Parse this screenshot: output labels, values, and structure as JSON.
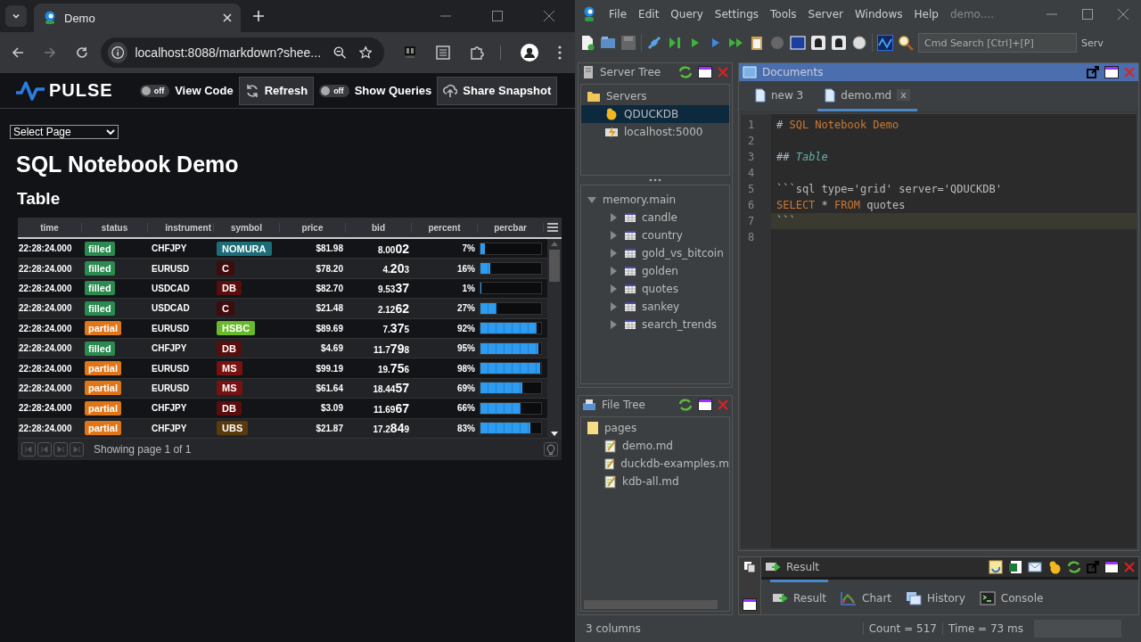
{
  "browser": {
    "tab_title": "Demo",
    "url": "localhost:8088/markdown?shee..."
  },
  "pulse": {
    "logo": "PULSE",
    "controls": [
      {
        "kind": "toggle",
        "label": "off",
        "on": false
      },
      {
        "kind": "caption",
        "label": "View Code"
      },
      {
        "kind": "button",
        "label": "Refresh"
      },
      {
        "kind": "toggle",
        "label": "off",
        "on": false
      },
      {
        "kind": "caption",
        "label": "Show Queries"
      },
      {
        "kind": "button",
        "label": "Share Snapshot"
      }
    ]
  },
  "page": {
    "select": "Select Page",
    "title": "SQL Notebook Demo",
    "subtitle": "Table"
  },
  "grid": {
    "columns": [
      "time",
      "status",
      "instrument",
      "symbol",
      "price",
      "bid",
      "percent",
      "percbar"
    ],
    "rows": [
      {
        "time": "22:28:24.000",
        "status": {
          "text": "filled",
          "color": "#2a8a4f"
        },
        "instrument": "CHFJPY",
        "symbol": {
          "text": "NOMURA",
          "color": "#1c6d78"
        },
        "price": "$81.98",
        "bid_pre": "8.00",
        "bid_big": "02",
        "percent": "7%",
        "level": 0.07
      },
      {
        "time": "22:28:24.000",
        "status": {
          "text": "filled",
          "color": "#2a8a4f"
        },
        "instrument": "EURUSD",
        "symbol": {
          "text": "C",
          "color": "#3e0c0c"
        },
        "price": "$78.20",
        "bid_pre": "4.",
        "bid_big": "20",
        "bid_post": "3",
        "percent": "16%",
        "level": 0.16
      },
      {
        "time": "22:28:24.000",
        "status": {
          "text": "filled",
          "color": "#2a8a4f"
        },
        "instrument": "USDCAD",
        "symbol": {
          "text": "DB",
          "color": "#5a0d0d"
        },
        "price": "$82.70",
        "bid_pre": "9.53",
        "bid_big": "37",
        "percent": "1%",
        "level": 0.01
      },
      {
        "time": "22:28:24.000",
        "status": {
          "text": "filled",
          "color": "#2a8a4f"
        },
        "instrument": "USDCAD",
        "symbol": {
          "text": "C",
          "color": "#3e0c0c"
        },
        "price": "$21.48",
        "bid_pre": "2.12",
        "bid_big": "62",
        "percent": "27%",
        "level": 0.27
      },
      {
        "time": "22:28:24.000",
        "status": {
          "text": "partial",
          "color": "#e0761a"
        },
        "instrument": "EURUSD",
        "symbol": {
          "text": "HSBC",
          "color": "#6ab82c"
        },
        "price": "$89.69",
        "bid_pre": "7.",
        "bid_big": "37",
        "bid_post": "5",
        "percent": "92%",
        "level": 0.92
      },
      {
        "time": "22:28:24.000",
        "status": {
          "text": "filled",
          "color": "#2a8a4f"
        },
        "instrument": "CHFJPY",
        "symbol": {
          "text": "DB",
          "color": "#5a0d0d"
        },
        "price": "$4.69",
        "bid_pre": "11.7",
        "bid_big": "79",
        "bid_post": "8",
        "percent": "95%",
        "level": 0.95
      },
      {
        "time": "22:28:24.000",
        "status": {
          "text": "partial",
          "color": "#e0761a"
        },
        "instrument": "EURUSD",
        "symbol": {
          "text": "MS",
          "color": "#7a1111"
        },
        "price": "$99.19",
        "bid_pre": "19.",
        "bid_big": "75",
        "bid_post": "6",
        "percent": "98%",
        "level": 0.98
      },
      {
        "time": "22:28:24.000",
        "status": {
          "text": "partial",
          "color": "#e0761a"
        },
        "instrument": "EURUSD",
        "symbol": {
          "text": "MS",
          "color": "#7a1111"
        },
        "price": "$61.64",
        "bid_pre": "18.44",
        "bid_big": "57",
        "percent": "69%",
        "level": 0.69
      },
      {
        "time": "22:28:24.000",
        "status": {
          "text": "partial",
          "color": "#e0761a"
        },
        "instrument": "CHFJPY",
        "symbol": {
          "text": "DB",
          "color": "#5a0d0d"
        },
        "price": "$3.09",
        "bid_pre": "11.69",
        "bid_big": "67",
        "percent": "66%",
        "level": 0.66
      },
      {
        "time": "22:28:24.000",
        "status": {
          "text": "partial",
          "color": "#e0761a"
        },
        "instrument": "CHFJPY",
        "symbol": {
          "text": "UBS",
          "color": "#5a3a0c"
        },
        "price": "$21.87",
        "bid_pre": "17.2",
        "bid_big": "84",
        "bid_post": "9",
        "percent": "83%",
        "level": 0.83
      }
    ],
    "pager": "Showing page 1 of 1"
  },
  "ide": {
    "menu": [
      "File",
      "Edit",
      "Query",
      "Settings",
      "Tools",
      "Server",
      "Windows",
      "Help"
    ],
    "title": "demo....",
    "search_placeholder": "Cmd Search [Ctrl]+[P]",
    "toolbar_cut": "Serv",
    "server_tree": {
      "title": "Server Tree",
      "root": "Servers",
      "servers": [
        {
          "name": "QDUCKDB",
          "selected": true
        },
        {
          "name": "localhost:5000",
          "selected": false
        }
      ]
    },
    "schema": {
      "name": "memory.main",
      "expanded": true,
      "tables": [
        {
          "name": "candle",
          "expanded": false
        },
        {
          "name": "country",
          "expanded": false
        },
        {
          "name": "gold_vs_bitcoin",
          "expanded": false
        },
        {
          "name": "golden",
          "expanded": false
        },
        {
          "name": "quotes",
          "expanded": false
        },
        {
          "name": "sankey",
          "expanded": false
        },
        {
          "name": "search_trends",
          "expanded": false
        }
      ]
    },
    "file_tree": {
      "title": "File Tree",
      "folder": "pages",
      "files": [
        "demo.md",
        "duckdb-examples.m",
        "kdb-all.md"
      ]
    },
    "documents": {
      "title": "Documents",
      "tabs": [
        {
          "label": "new 3",
          "selected": false
        },
        {
          "label": "demo.md",
          "selected": true,
          "close": "x"
        }
      ],
      "lines": [
        {
          "number": "1",
          "current": false,
          "tokens": [
            {
              "text": "# ",
              "kind": "mark"
            },
            {
              "text": "SQL Notebook Demo",
              "kind": "heading"
            }
          ]
        },
        {
          "number": "2",
          "current": false
        },
        {
          "number": "3",
          "current": false,
          "tokens": [
            {
              "text": "## ",
              "kind": "mark"
            },
            {
              "text": "Table",
              "kind": "emphasis"
            }
          ]
        },
        {
          "number": "4",
          "current": false
        },
        {
          "number": "5",
          "current": false,
          "tokens": [
            {
              "text": "```sql type='grid' server='QDUCKDB'",
              "kind": "plain"
            }
          ]
        },
        {
          "number": "6",
          "current": false,
          "tokens": [
            {
              "text": "SELECT",
              "kind": "keyword"
            },
            {
              "text": " * ",
              "kind": "plain"
            },
            {
              "text": "FROM",
              "kind": "keyword"
            },
            {
              "text": " quotes",
              "kind": "plain"
            }
          ]
        },
        {
          "number": "7",
          "current": true,
          "tokens": [
            {
              "text": "```",
              "kind": "plain"
            }
          ]
        },
        {
          "number": "8",
          "current": false
        }
      ]
    },
    "result": {
      "title": "Result",
      "tabs": [
        {
          "label": "Result",
          "selected": true
        },
        {
          "label": "Chart",
          "selected": false
        },
        {
          "label": "History",
          "selected": false
        },
        {
          "label": "Console",
          "selected": false
        }
      ]
    },
    "status": {
      "left": "3 columns",
      "count": "Count = 517",
      "time": "Time = 73 ms"
    }
  }
}
